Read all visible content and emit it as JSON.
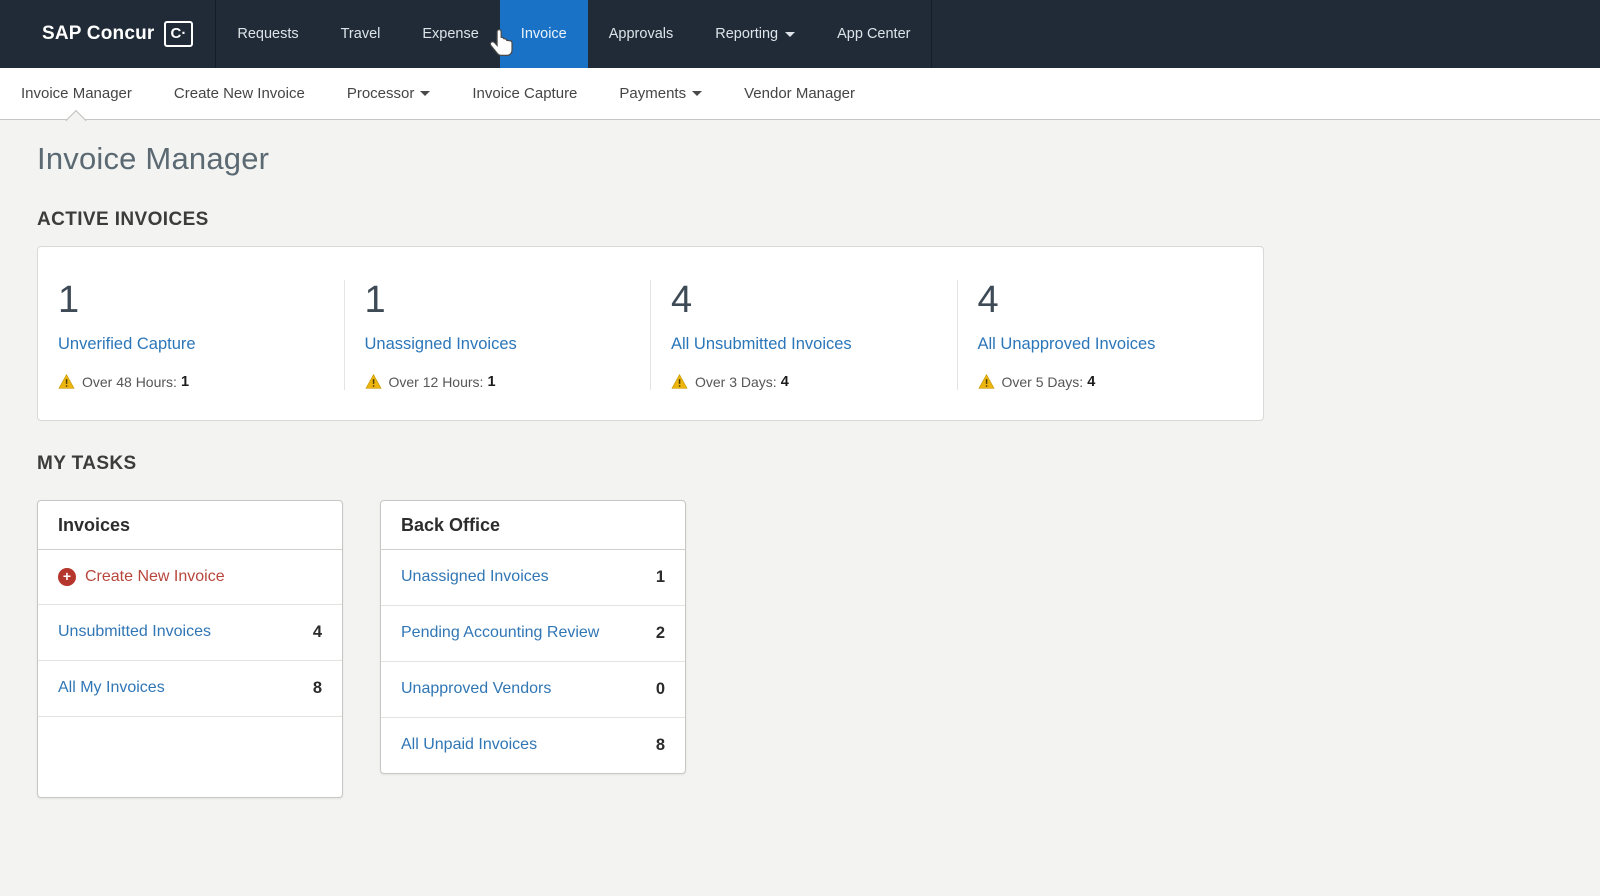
{
  "topnav": {
    "logo_text": "SAP Concur",
    "logo_icon": "C·",
    "items": [
      {
        "label": "Requests"
      },
      {
        "label": "Travel"
      },
      {
        "label": "Expense"
      },
      {
        "label": "Invoice",
        "active": true
      },
      {
        "label": "Approvals"
      },
      {
        "label": "Reporting",
        "dropdown": true
      },
      {
        "label": "App Center"
      }
    ]
  },
  "subnav": {
    "items": [
      {
        "label": "Invoice Manager",
        "active": true
      },
      {
        "label": "Create New Invoice"
      },
      {
        "label": "Processor",
        "dropdown": true
      },
      {
        "label": "Invoice Capture"
      },
      {
        "label": "Payments",
        "dropdown": true
      },
      {
        "label": "Vendor Manager"
      }
    ]
  },
  "page": {
    "title": "Invoice Manager"
  },
  "active_invoices": {
    "heading": "ACTIVE INVOICES",
    "cards": [
      {
        "count": "1",
        "label": "Unverified Capture",
        "warning_label": "Over 48 Hours:",
        "warning_count": "1"
      },
      {
        "count": "1",
        "label": "Unassigned Invoices",
        "warning_label": "Over 12 Hours:",
        "warning_count": "1"
      },
      {
        "count": "4",
        "label": "All Unsubmitted Invoices",
        "warning_label": "Over 3 Days:",
        "warning_count": "4"
      },
      {
        "count": "4",
        "label": "All Unapproved Invoices",
        "warning_label": "Over 5 Days:",
        "warning_count": "4"
      }
    ]
  },
  "my_tasks": {
    "heading": "MY TASKS",
    "invoices_panel": {
      "title": "Invoices",
      "action_row": {
        "label": "Create New Invoice"
      },
      "rows": [
        {
          "label": "Unsubmitted Invoices",
          "count": "4"
        },
        {
          "label": "All My Invoices",
          "count": "8"
        }
      ]
    },
    "back_office_panel": {
      "title": "Back Office",
      "rows": [
        {
          "label": "Unassigned Invoices",
          "count": "1"
        },
        {
          "label": "Pending Accounting Review",
          "count": "2"
        },
        {
          "label": "Unapproved Vendors",
          "count": "0"
        },
        {
          "label": "All Unpaid Invoices",
          "count": "8"
        }
      ]
    }
  },
  "colors": {
    "topnav_bg": "#202b37",
    "active_tab_blue": "#1a72c6",
    "link_blue": "#2b76b9",
    "action_red": "#b8463c",
    "warning_yellow": "#edb50d",
    "content_bg": "#f3f3f1"
  }
}
